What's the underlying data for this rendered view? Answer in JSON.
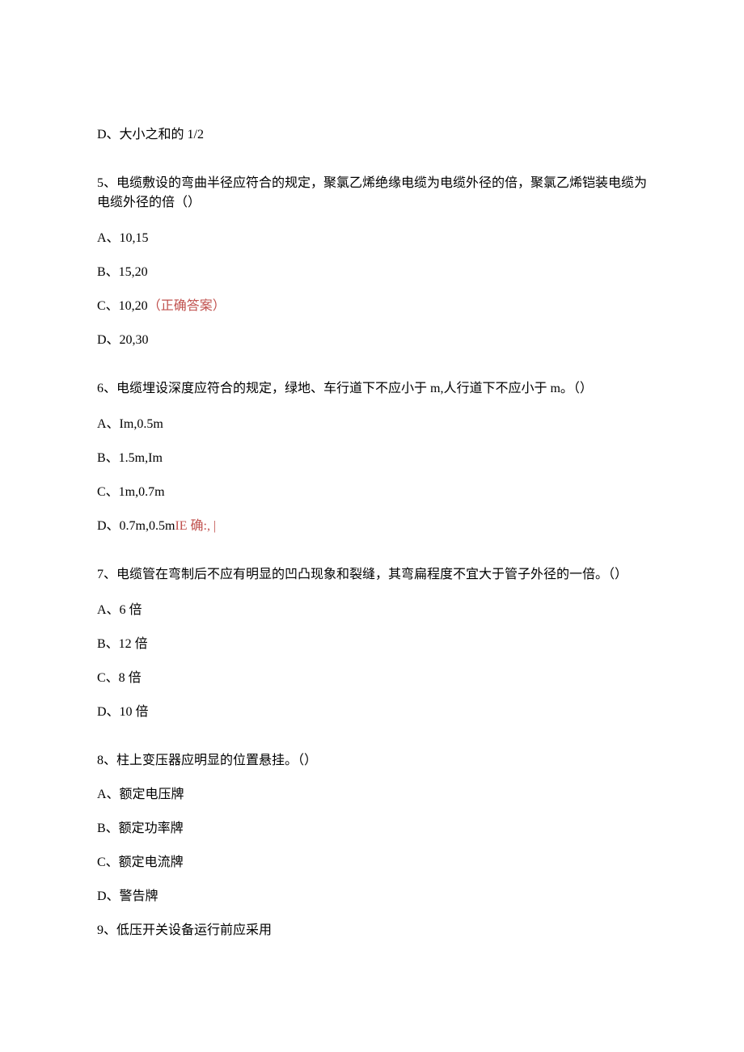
{
  "q4": {
    "optD": "D、大小之和的 1/2"
  },
  "q5": {
    "stem": "5、电缆敷设的弯曲半径应符合的规定，聚氯乙烯绝缘电缆为电缆外径的倍，聚氯乙烯铠装电缆为电缆外径的倍（）",
    "optA": "A、10,15",
    "optB": "B、15,20",
    "optC_text": "C、10,20",
    "optC_correct": "（正确答案）",
    "optD": "D、20,30"
  },
  "q6": {
    "stem": "6、电缆埋设深度应符合的规定，绿地、车行道下不应小于 m,人行道下不应小于 m。（）",
    "optA": "A、Im,0.5m",
    "optB": "B、1.5m,Im",
    "optC": "C、1m,0.7m",
    "optD_text": "D、0.7m,0.5m",
    "optD_hint": "IE 确:,  |"
  },
  "q7": {
    "stem": "7、电缆管在弯制后不应有明显的凹凸现象和裂缝，其弯扁程度不宜大于管子外径的一倍。（）",
    "optA": "A、6 倍",
    "optB": "B、12 倍",
    "optC": "C、8 倍",
    "optD": "D、10 倍"
  },
  "q8": {
    "stem": "8、柱上变压器应明显的位置悬挂。（）",
    "optA": "A、额定电压牌",
    "optB": "B、额定功率牌",
    "optC": "C、额定电流牌",
    "optD": "D、警告牌"
  },
  "q9": {
    "stem": "9、低压开关设备运行前应采用"
  }
}
